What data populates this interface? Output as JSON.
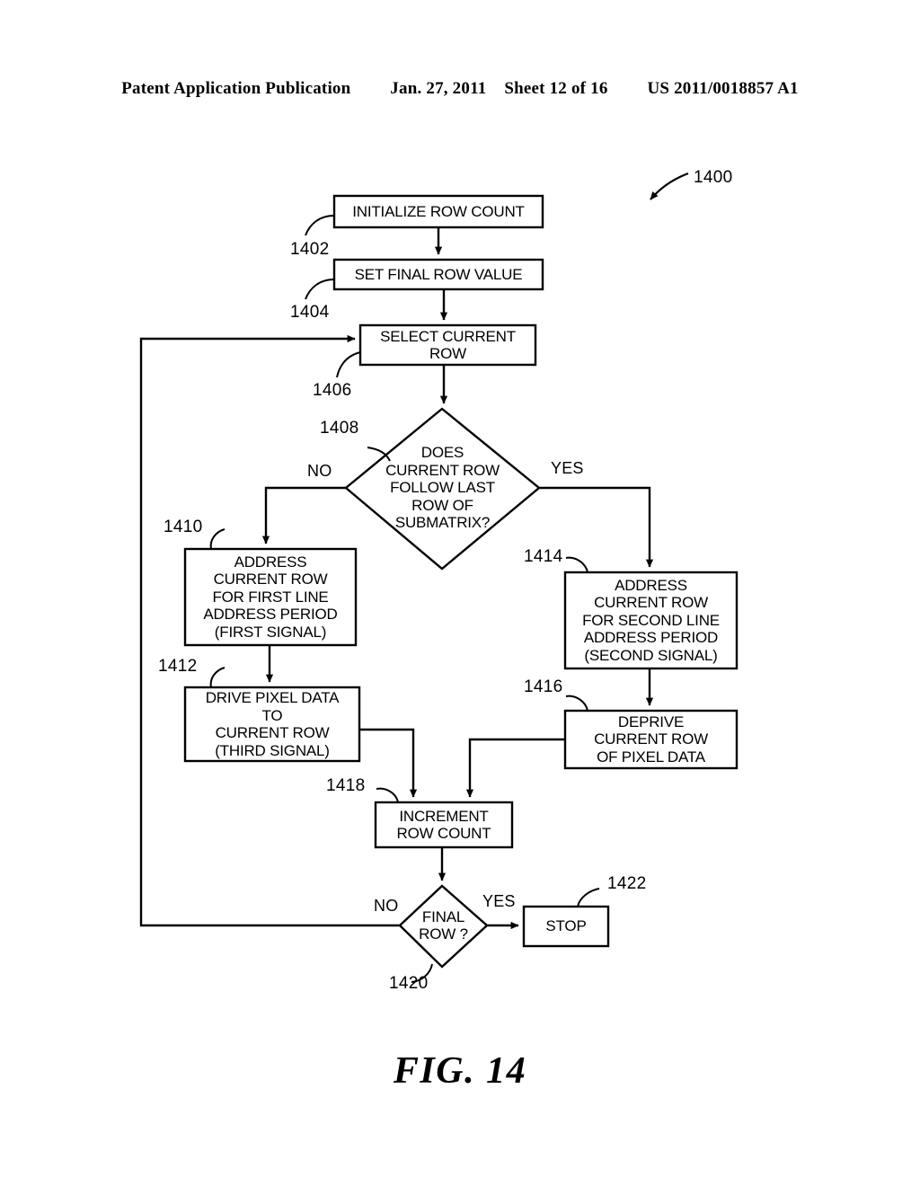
{
  "header": {
    "publication": "Patent Application Publication",
    "date": "Jan. 27, 2011",
    "sheet": "Sheet 12 of 16",
    "patent_number": "US 2011/0018857 A1"
  },
  "figure": {
    "caption": "FIG. 14",
    "diagram_ref": "1400"
  },
  "nodes": {
    "initialize_row_count": {
      "ref": "1402",
      "shape": "process",
      "lines": [
        "INITIALIZE ROW COUNT"
      ]
    },
    "set_final_row_value": {
      "ref": "1404",
      "shape": "process",
      "lines": [
        "SET FINAL ROW VALUE"
      ]
    },
    "select_current_row": {
      "ref": "1406",
      "shape": "process",
      "lines": [
        "SELECT CURRENT",
        "ROW"
      ]
    },
    "follow_last_row_decision": {
      "ref": "1408",
      "shape": "decision",
      "lines": [
        "DOES",
        "CURRENT ROW",
        "FOLLOW LAST",
        "ROW OF",
        "SUBMATRIX?"
      ]
    },
    "address_first_line": {
      "ref": "1410",
      "shape": "process",
      "lines": [
        "ADDRESS",
        "CURRENT ROW",
        "FOR FIRST LINE",
        "ADDRESS PERIOD",
        "(FIRST SIGNAL)"
      ]
    },
    "drive_pixel_data": {
      "ref": "1412",
      "shape": "process",
      "lines": [
        "DRIVE PIXEL DATA",
        "TO",
        "CURRENT ROW",
        "(THIRD SIGNAL)"
      ]
    },
    "address_second_line": {
      "ref": "1414",
      "shape": "process",
      "lines": [
        "ADDRESS",
        "CURRENT ROW",
        "FOR SECOND LINE",
        "ADDRESS PERIOD",
        "(SECOND SIGNAL)"
      ]
    },
    "deprive_pixel_data": {
      "ref": "1416",
      "shape": "process",
      "lines": [
        "DEPRIVE",
        "CURRENT ROW",
        "OF PIXEL DATA"
      ]
    },
    "increment_row_count": {
      "ref": "1418",
      "shape": "process",
      "lines": [
        "INCREMENT",
        "ROW COUNT"
      ]
    },
    "final_row_decision": {
      "ref": "1420",
      "shape": "decision",
      "lines": [
        "FINAL",
        "ROW ?"
      ]
    },
    "stop": {
      "ref": "1422",
      "shape": "terminator",
      "lines": [
        "STOP"
      ]
    }
  },
  "branch_labels": {
    "decision_1408_no": "NO",
    "decision_1408_yes": "YES",
    "decision_1420_no": "NO",
    "decision_1420_yes": "YES"
  },
  "colors": {
    "ink": "#000000",
    "paper": "#ffffff"
  }
}
